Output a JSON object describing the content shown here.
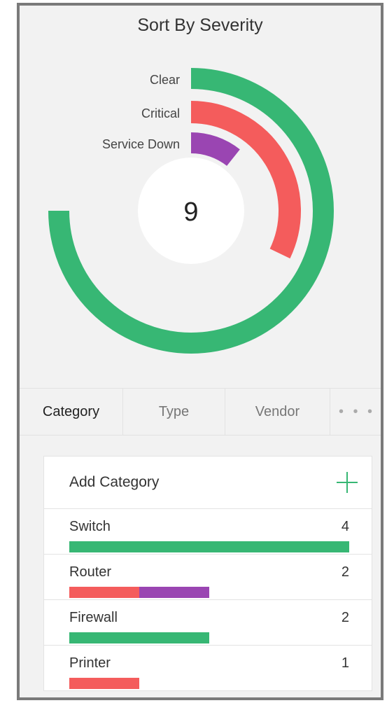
{
  "title": "Sort By Severity",
  "colors": {
    "clear": "#37b774",
    "critical": "#f45c5c",
    "service_down": "#9a45b2"
  },
  "chart_data": {
    "type": "radial-bar",
    "center_value": "9",
    "series": [
      {
        "name": "Clear",
        "value": 7,
        "color": "#37b774"
      },
      {
        "name": "Critical",
        "value": 3,
        "color": "#f45c5c"
      },
      {
        "name": "Service Down",
        "value": 1,
        "color": "#9a45b2"
      }
    ]
  },
  "tabs": [
    {
      "label": "Category",
      "active": true
    },
    {
      "label": "Type",
      "active": false
    },
    {
      "label": "Vendor",
      "active": false
    },
    {
      "label": "• • •",
      "active": false
    }
  ],
  "list": {
    "add_label": "Add Category",
    "max_count": 4,
    "items": [
      {
        "name": "Switch",
        "count": "4",
        "segments": [
          {
            "severity": "clear",
            "value": 4
          }
        ]
      },
      {
        "name": "Router",
        "count": "2",
        "segments": [
          {
            "severity": "critical",
            "value": 1
          },
          {
            "severity": "service_down",
            "value": 1
          }
        ]
      },
      {
        "name": "Firewall",
        "count": "2",
        "segments": [
          {
            "severity": "clear",
            "value": 2
          }
        ]
      },
      {
        "name": "Printer",
        "count": "1",
        "segments": [
          {
            "severity": "critical",
            "value": 1
          }
        ]
      }
    ]
  }
}
